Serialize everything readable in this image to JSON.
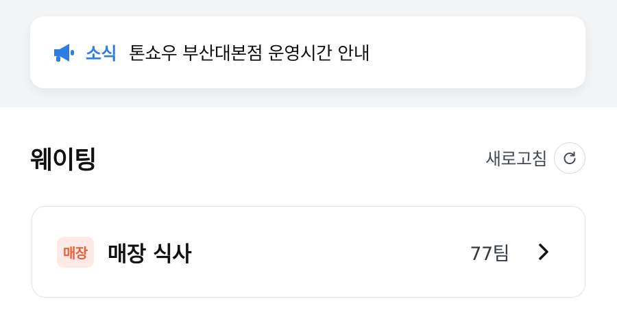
{
  "notice": {
    "icon": "megaphone-icon",
    "tag": "소식",
    "text": "톤쇼우 부산대본점 운영시간 안내",
    "tag_color": "#2f7de1"
  },
  "section": {
    "title": "웨이팅",
    "refresh_label": "새로고침",
    "refresh_icon": "refresh-icon"
  },
  "queue": {
    "badge": "매장",
    "label": "매장 식사",
    "count": "77팀",
    "icon": "chevron-right-icon",
    "badge_color": "#e8613f",
    "badge_bg": "#fdeae6"
  }
}
